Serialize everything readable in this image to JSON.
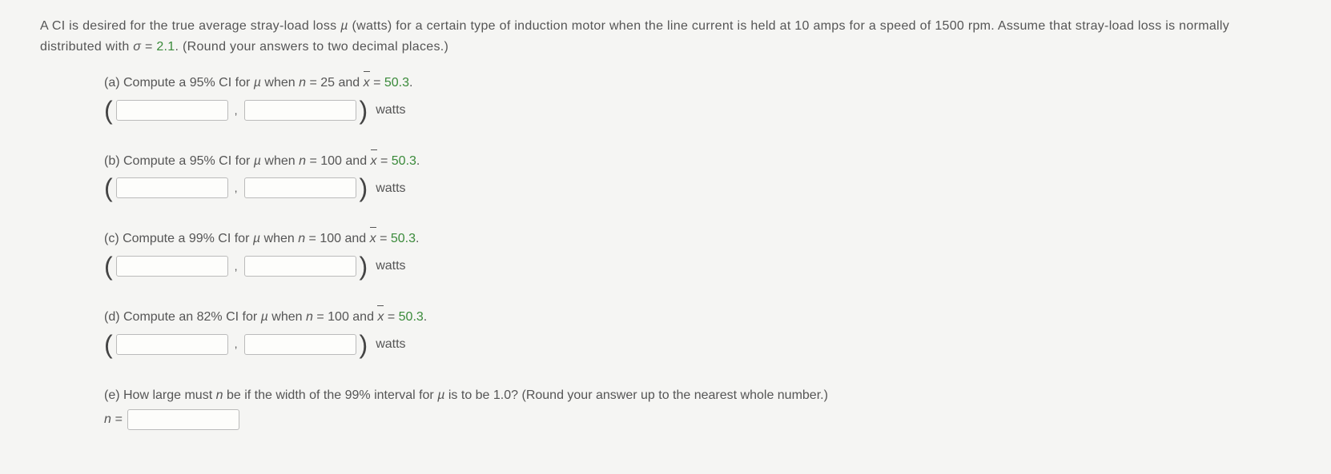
{
  "intro": {
    "part1": "A CI is desired for the true average stray-load loss ",
    "mu": "µ",
    "part2": " (watts) for a certain type of induction motor when the line current is held at 10 amps for a speed of 1500 rpm. Assume that stray-load loss is normally distributed with ",
    "sigma": "σ",
    "part3": " = ",
    "sigma_value": "2.1",
    "part4": ". (Round your answers to two decimal places.)"
  },
  "parts": {
    "a": {
      "label": "(a) Compute a 95% CI for ",
      "mu": "µ",
      "when": " when ",
      "n": "n",
      "eq1": " = 25 and ",
      "x": "x",
      "eq2": " = ",
      "xval": "50.3",
      "period": ".",
      "unit": "watts"
    },
    "b": {
      "label": "(b) Compute a 95% CI for ",
      "mu": "µ",
      "when": " when ",
      "n": "n",
      "eq1": " = 100 and ",
      "x": "x",
      "eq2": " = ",
      "xval": "50.3",
      "period": ".",
      "unit": "watts"
    },
    "c": {
      "label": "(c) Compute a 99% CI for ",
      "mu": "µ",
      "when": " when ",
      "n": "n",
      "eq1": " = 100 and ",
      "x": "x",
      "eq2": " = ",
      "xval": "50.3",
      "period": ".",
      "unit": "watts"
    },
    "d": {
      "label": "(d) Compute an 82% CI for ",
      "mu": "µ",
      "when": " when ",
      "n": "n",
      "eq1": " = 100 and ",
      "x": "x",
      "eq2": " = ",
      "xval": "50.3",
      "period": ".",
      "unit": "watts"
    },
    "e": {
      "label": "(e) How large must ",
      "n": "n",
      "text2": " be if the width of the 99% interval for ",
      "mu": "µ",
      "text3": " is to be 1.0? (Round your answer up to the nearest whole number.)",
      "prefix": "n ="
    }
  },
  "comma": ","
}
